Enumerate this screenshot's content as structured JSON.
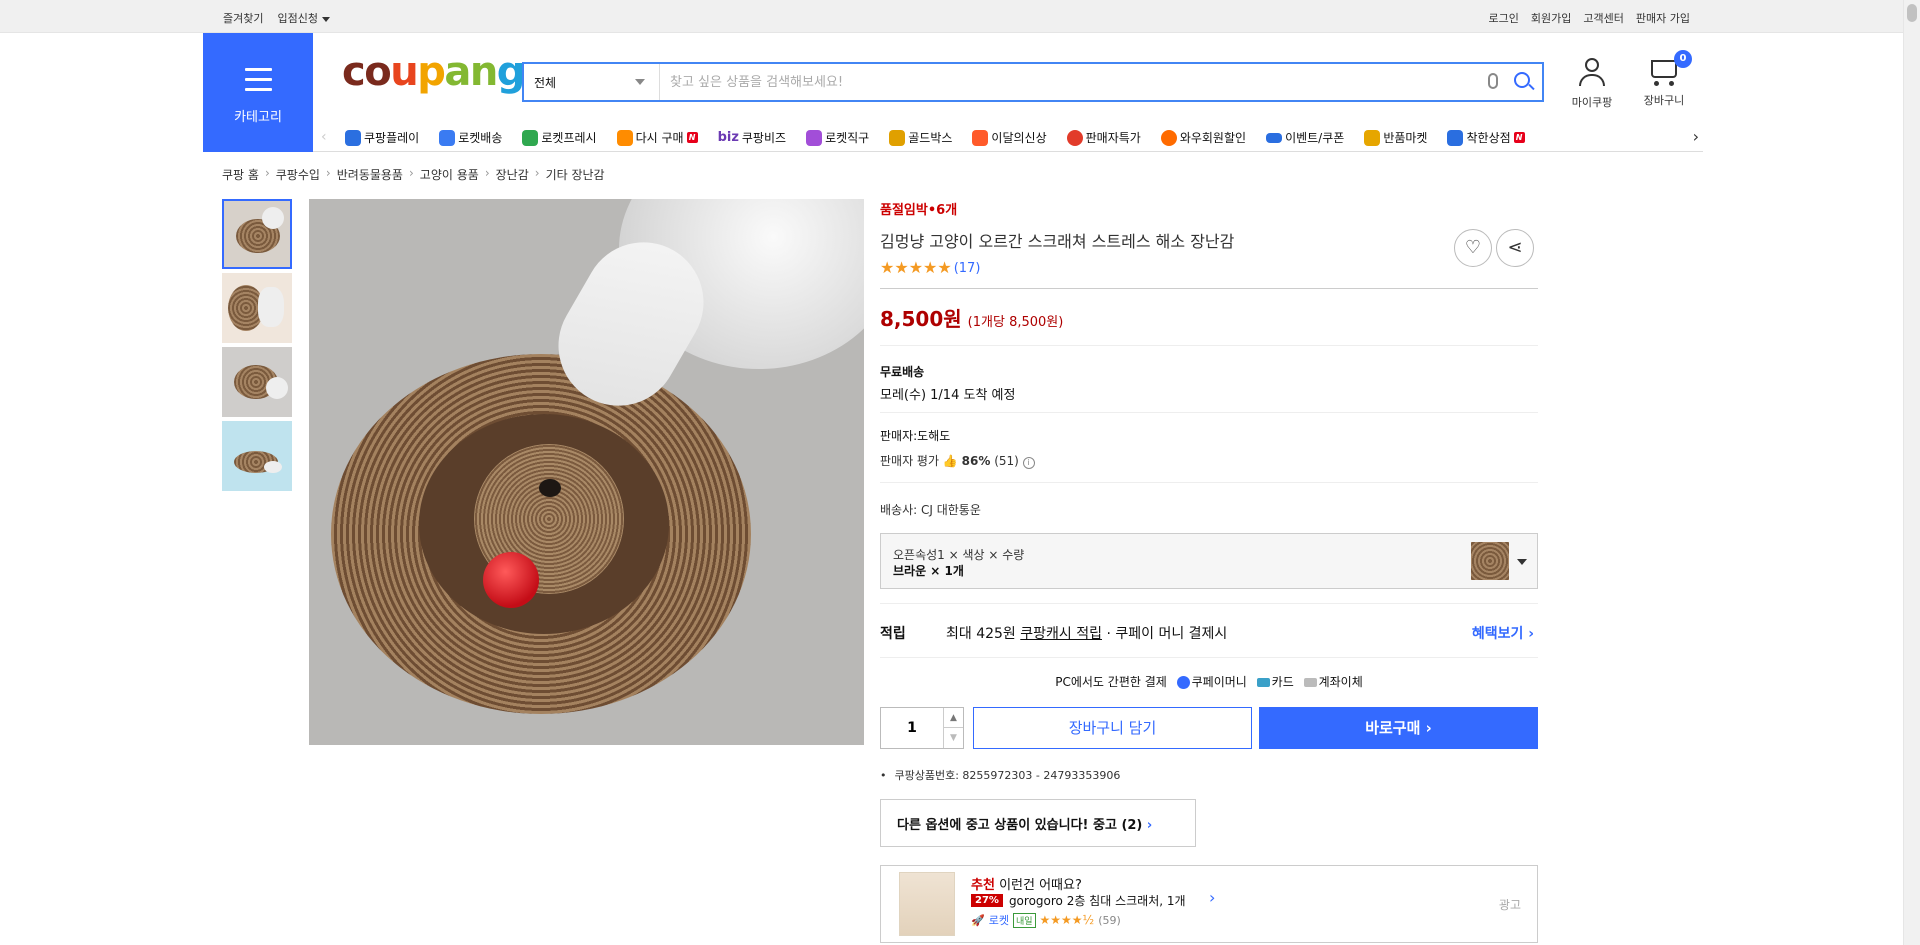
{
  "topbar": {
    "left": [
      "즐겨찾기",
      "입점신청"
    ],
    "right": [
      "로그인",
      "회원가입",
      "고객센터",
      "판매자 가입"
    ]
  },
  "header": {
    "category_label": "카테고리",
    "logo": {
      "c1": "co",
      "c2": "u",
      "c3": "p",
      "c4": "an",
      "c5": "g"
    },
    "search": {
      "category": "전체",
      "placeholder": "찾고 싶은 상품을 검색해보세요!"
    },
    "my_coupang": "마이쿠팡",
    "cart": {
      "label": "장바구니",
      "count": "0"
    }
  },
  "nav": {
    "items": [
      {
        "label": "쿠팡플레이",
        "color": "#2b6fe0"
      },
      {
        "label": "로켓배송",
        "color": "#3a7bf2"
      },
      {
        "label": "로켓프레시",
        "color": "#2fa84f"
      },
      {
        "label": "다시 구매",
        "color": "#ff8c00"
      },
      {
        "label": "쿠팡비즈",
        "color": "#6b3ab3"
      },
      {
        "label": "로켓직구",
        "color": "#a24ed8"
      },
      {
        "label": "골드박스",
        "color": "#e0a000"
      },
      {
        "label": "이달의신상",
        "color": "#ff5a2a"
      },
      {
        "label": "판매자특가",
        "color": "#e23b2a"
      },
      {
        "label": "와우회원할인",
        "color": "#ff6b00"
      },
      {
        "label": "이벤트/쿠폰",
        "color": "#2a6ee0"
      },
      {
        "label": "반품마켓",
        "color": "#e6a600"
      },
      {
        "label": "착한상점",
        "color": "#2a6ee0"
      }
    ],
    "new_badge": "N",
    "biz": "biz"
  },
  "breadcrumb": [
    "쿠팡 홈",
    "쿠팡수입",
    "반려동물용품",
    "고양이 용품",
    "장난감",
    "기타 장난감"
  ],
  "product": {
    "stock_label": "품절임박•6개",
    "title": "김멍냥 고양이 오르간 스크래쳐 스트레스 해소 장난감",
    "stars": "★★★★★",
    "rating_count": "(17)",
    "price": "8,500원",
    "unit_price": "(1개당 8,500원)",
    "shipping_title": "무료배송",
    "arrival": "모레(수) 1/14 도착 예정",
    "seller": "판매자:도해도",
    "seller_rating_label": "판매자 평가",
    "seller_rating_value": "86%",
    "seller_rating_count": "(51)",
    "delivery_company": "배송사:  CJ 대한통운",
    "option_header": "오픈속성1 × 색상 × 수량",
    "option_value": "브라운 × 1개",
    "reward_label": "적립",
    "reward_text_1": "최대 425원",
    "reward_text_2": "쿠팡캐시 적립",
    "reward_text_3": "· 쿠페이 머니 결제시",
    "reward_more": "혜택보기 ›",
    "pay_title": "PC에서도 간편한 결제",
    "pay_methods": [
      "쿠페이머니",
      "카드",
      "계좌이체"
    ],
    "quantity": "1",
    "add_to_cart": "장바구니 담기",
    "buy_now": "바로구매 ›",
    "product_id": "쿠팡상품번호: 8255972303 - 24793353906",
    "used_notice_1": "다른 옵션에 중고 상품이 있습니다! 중고 (2)",
    "used_notice_2": "›"
  },
  "recommend": {
    "title_bold": "추천",
    "title_rest": "이런건 어때요?",
    "discount": "27%",
    "name": "gorogoro 2층 침대 스크래처, 1개",
    "rocket": "로켓",
    "tomorrow": "내일",
    "stars": "★★★★½",
    "count": "(59)",
    "ad_label": "광고"
  }
}
